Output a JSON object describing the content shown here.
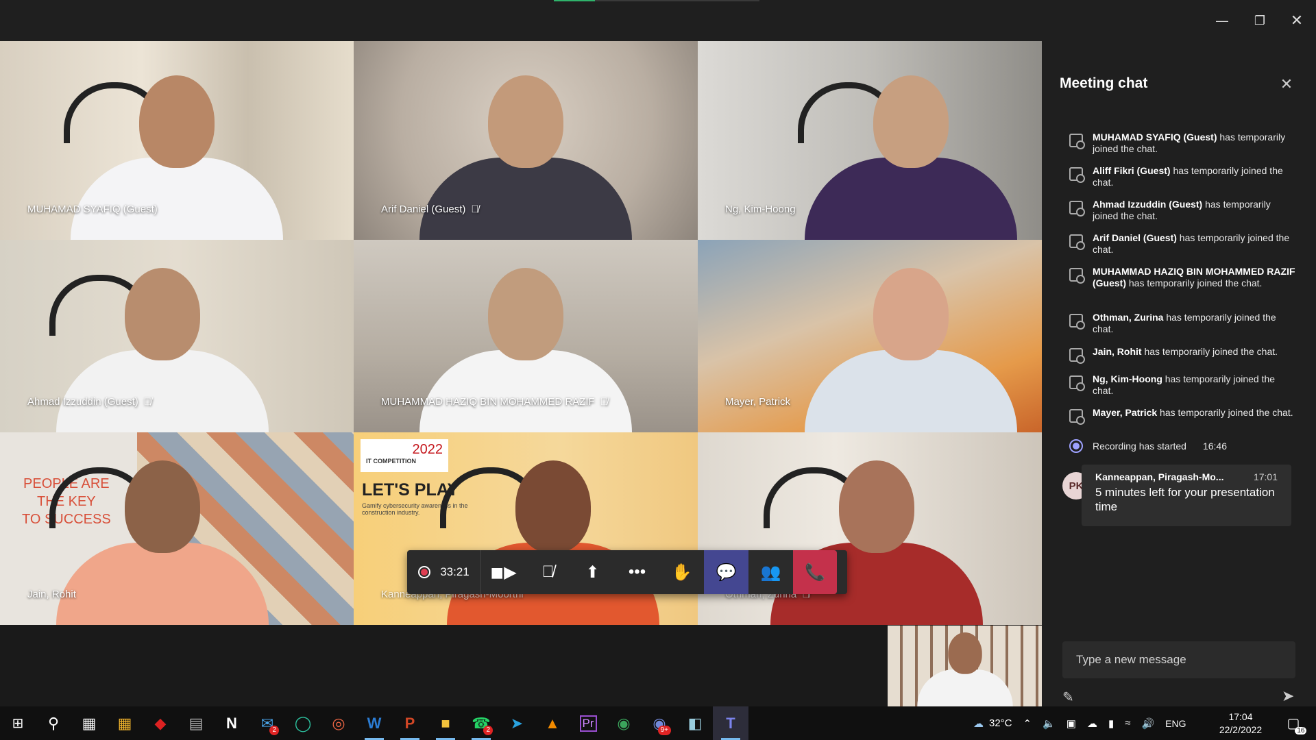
{
  "stage": {
    "tiles": [
      {
        "name": "MUHAMAD SYAFIQ (Guest)",
        "muted": false
      },
      {
        "name": "Arif Daniel (Guest)",
        "muted": true
      },
      {
        "name": "Ng, Kim-Hoong",
        "muted": false
      },
      {
        "name": "Ahmad Izzuddin (Guest)",
        "muted": true
      },
      {
        "name": "MUHAMMAD HAZIQ BIN MOHAMMED RAZIF",
        "muted": true
      },
      {
        "name": "Mayer, Patrick",
        "muted": false
      },
      {
        "name": "Jain, Rohit",
        "muted": false
      },
      {
        "name": "Kanneappan, Piragash-Moorthi",
        "muted": false
      },
      {
        "name": "Othman, Zurina",
        "muted": true
      }
    ],
    "poster_text": {
      "line1": "PEOPLE ARE",
      "line2": "THE KEY",
      "line3": "TO SUCCESS"
    },
    "slide": {
      "year": "2022",
      "subtitle": "IT COMPETITION",
      "headline": "LET'S PLAY",
      "tagline": "Gamify cybersecurity awareness in the construction industry."
    }
  },
  "controls": {
    "timer": "33:21"
  },
  "chat": {
    "title": "Meeting chat",
    "events": [
      {
        "who": "MUHAMAD SYAFIQ (Guest)",
        "text": " has temporarily joined the chat."
      },
      {
        "who": "Aliff Fikri (Guest)",
        "text": " has temporarily joined the chat."
      },
      {
        "who": "Ahmad Izzuddin (Guest)",
        "text": " has temporarily joined the chat."
      },
      {
        "who": "Arif Daniel (Guest)",
        "text": " has temporarily joined the chat."
      },
      {
        "who": "MUHAMMAD HAZIQ BIN MOHAMMED RAZIF (Guest)",
        "text": " has temporarily joined the chat."
      },
      {
        "who": "Othman, Zurina",
        "text": " has temporarily joined the chat."
      },
      {
        "who": "Jain, Rohit",
        "text": " has temporarily joined the chat."
      },
      {
        "who": "Ng, Kim-Hoong",
        "text": " has temporarily joined the chat."
      },
      {
        "who": "Mayer, Patrick",
        "text": " has temporarily joined the chat."
      }
    ],
    "recording": {
      "text": "Recording has started",
      "time": "16:46"
    },
    "message": {
      "initials": "PK",
      "sender": "Kanneappan, Piragash-Mo...",
      "time": "17:01",
      "body": "5 minutes left for your presentation time"
    },
    "compose_placeholder": "Type a new message"
  },
  "taskbar": {
    "mail_badge": "2",
    "whatsapp_badge": "2",
    "discord_badge": "9+",
    "weather": "32°C",
    "lang": "ENG",
    "time": "17:04",
    "date": "22/2/2022",
    "notif_count": "16"
  }
}
